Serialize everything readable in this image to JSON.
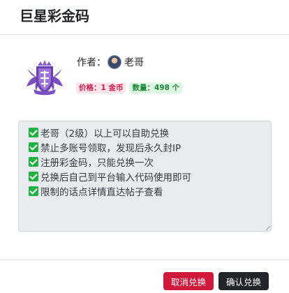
{
  "modal": {
    "title": "巨星彩金码"
  },
  "product": {
    "author_label": "作者：",
    "author_name": "老哥",
    "price_badge": "价格：1 金币",
    "quantity_badge": "数量：498 个"
  },
  "notes": [
    "老哥（2级）以上可以自助兑换",
    "禁止多账号领取，发现后永久封IP",
    "注册彩金码，只能兑换一次",
    "兑换后自己到平台输入代码使用即可",
    "限制的话点详情直达帖子查看"
  ],
  "footer": {
    "cancel_label": "取消兑换",
    "confirm_label": "确认兑换"
  },
  "colors": {
    "danger": "#d1193c",
    "dark": "#212529",
    "success": "#1fb141",
    "logo_purple": "#6a3fa8"
  },
  "icons": [
    "crown-shield-logo",
    "check-icon",
    "avatar"
  ]
}
